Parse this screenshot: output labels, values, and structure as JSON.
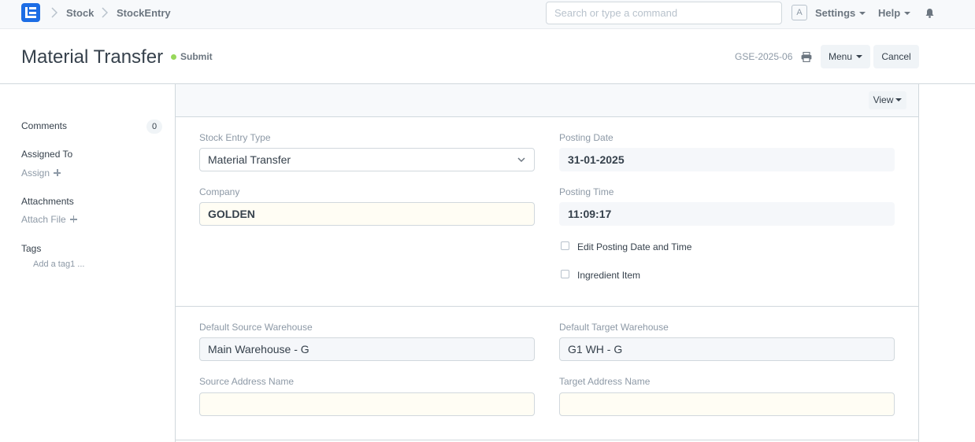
{
  "navbar": {
    "breadcrumbs": [
      "Stock",
      "StockEntry"
    ],
    "search_placeholder": "Search or type a command",
    "avatar_letter": "A",
    "settings_label": "Settings",
    "help_label": "Help"
  },
  "header": {
    "title": "Material Transfer",
    "status": "Submit",
    "status_color": "#98d85b",
    "doc_name": "GSE-2025-06",
    "menu_label": "Menu",
    "cancel_label": "Cancel"
  },
  "sidebar": {
    "comments_label": "Comments",
    "comments_count": "0",
    "assigned_to_label": "Assigned To",
    "assign_label": "Assign",
    "attachments_label": "Attachments",
    "attach_file_label": "Attach File",
    "tags_label": "Tags",
    "add_tag_label": "Add a tag1 ..."
  },
  "form": {
    "view_label": "View",
    "stock_entry_type": {
      "label": "Stock Entry Type",
      "value": "Material Transfer"
    },
    "company": {
      "label": "Company",
      "value": "GOLDEN"
    },
    "posting_date": {
      "label": "Posting Date",
      "value": "31-01-2025"
    },
    "posting_time": {
      "label": "Posting Time",
      "value": "11:09:17"
    },
    "edit_posting": {
      "label": "Edit Posting Date and Time",
      "checked": false
    },
    "ingredient_item": {
      "label": "Ingredient Item",
      "checked": false
    },
    "default_source_warehouse": {
      "label": "Default Source Warehouse",
      "value": "Main Warehouse - G"
    },
    "default_target_warehouse": {
      "label": "Default Target Warehouse",
      "value": "G1 WH - G"
    },
    "source_address_name": {
      "label": "Source Address Name",
      "value": ""
    },
    "target_address_name": {
      "label": "Target Address Name",
      "value": ""
    }
  },
  "colors": {
    "brand": "#1c6de5",
    "required_field_bg": "#fffdf4",
    "readonly_field_bg": "#f5f7fa"
  }
}
